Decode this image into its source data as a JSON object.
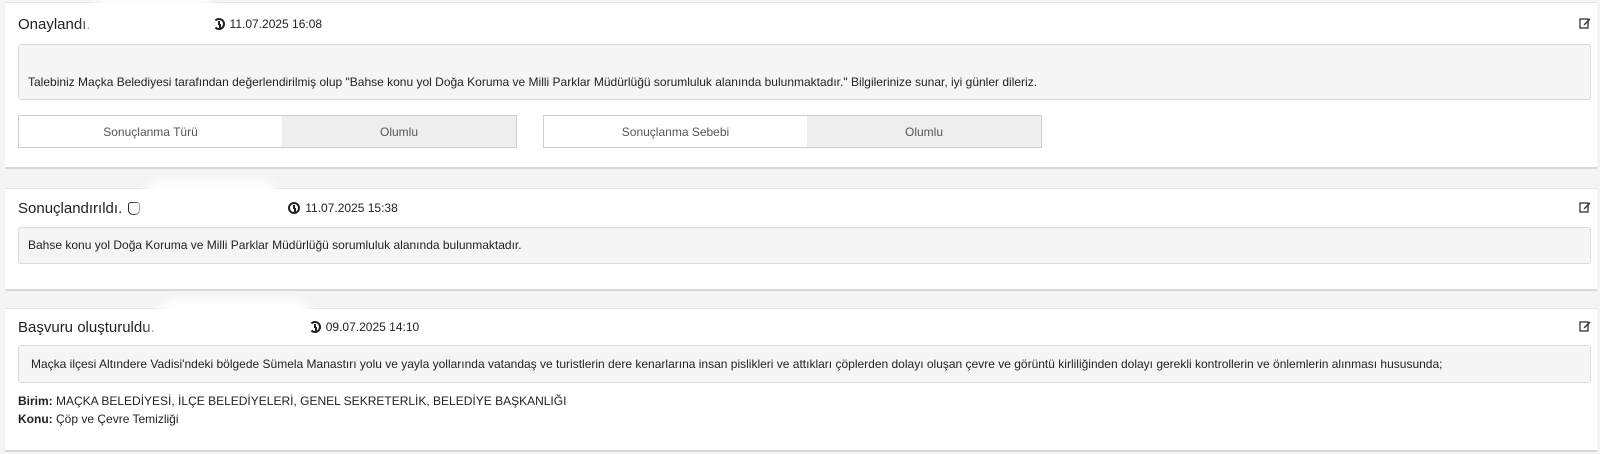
{
  "entries": [
    {
      "title": "Onaylandı.",
      "date": "11.07.2025 16:08",
      "message": "Talebiniz Maçka Belediyesi tarafından değerlendirilmiş olup \"Bahse konu yol Doğa Koruma ve Milli Parklar Müdürlüğü sorumluluk alanında bulunmaktadır.\" Bilgilerinize sunar, iyi günler dileriz.",
      "fields": [
        {
          "label": "Sonuçlanma Türü",
          "value": "Olumlu"
        },
        {
          "label": "Sonuçlanma Sebebi",
          "value": "Olumlu"
        }
      ]
    },
    {
      "title": "Sonuçlandırıldı.",
      "date": "11.07.2025 15:38",
      "message": "Bahse konu yol Doğa Koruma ve Milli Parklar Müdürlüğü sorumluluk alanında bulunmaktadır."
    },
    {
      "title": "Başvuru oluşturuldu.",
      "date": "09.07.2025 14:10",
      "message": "Maçka ilçesi Altındere Vadisi'ndeki bölgede Sümela Manastırı yolu ve yayla yollarında  vatandaş ve turistlerin dere kenarlarına insan pislikleri ve attıkları çöplerden dolayı oluşan çevre ve görüntü kirliliğinden dolayı gerekli kontrollerin ve önlemlerin alınması hususunda;",
      "unit_label": "Birim:",
      "unit_value": "MAÇKA BELEDİYESİ, İLÇE BELEDİYELERİ, GENEL SEKRETERLİK, BELEDİYE BAŞKANLIĞI",
      "subject_label": "Konu:",
      "subject_value": "Çöp ve Çevre Temizliği"
    }
  ],
  "icons": {
    "date": "clock-icon",
    "edit": "edit-icon",
    "actor": "hand-icon"
  }
}
